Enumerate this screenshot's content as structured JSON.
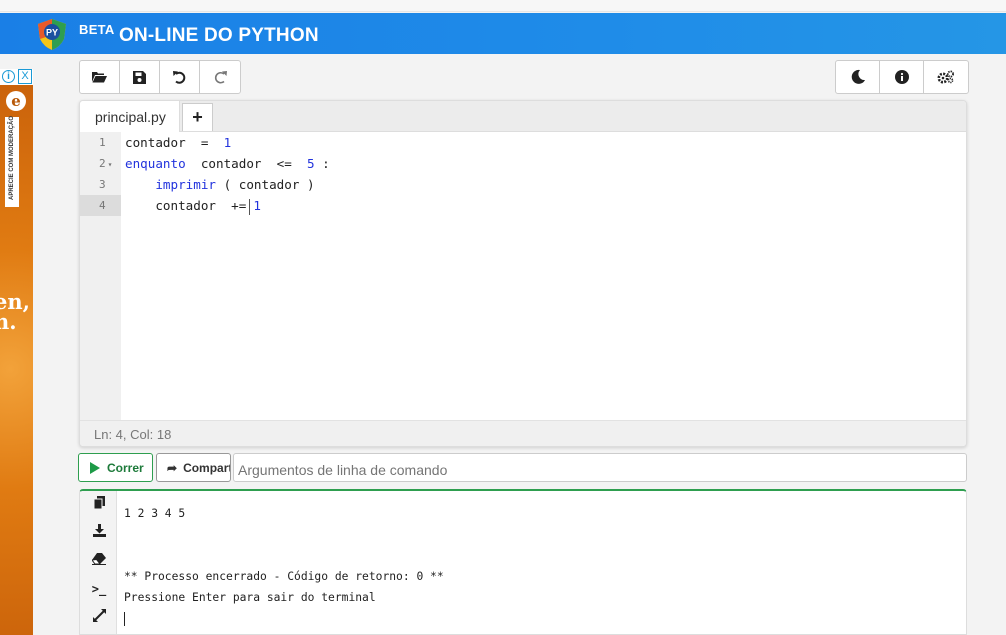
{
  "header": {
    "beta": "BETA",
    "brand": "ON-LINE DO PYTHON",
    "logo_text": "PY",
    "color": "#1f8ce8"
  },
  "ad": {
    "info": "i",
    "close": "X",
    "vertical_text": "APRECIE COM MODERAÇÃO",
    "text_line1": "en,",
    "text_line2": "n."
  },
  "toolbar_left": [
    {
      "name": "open-folder-icon"
    },
    {
      "name": "save-icon"
    },
    {
      "name": "undo-icon"
    },
    {
      "name": "redo-icon"
    }
  ],
  "toolbar_right": [
    {
      "name": "moon-icon"
    },
    {
      "name": "info-icon"
    },
    {
      "name": "settings-icon"
    }
  ],
  "editor": {
    "tab_label": "principal.py",
    "add_tab": "+",
    "line_numbers": [
      "1",
      "2",
      "3",
      "4"
    ],
    "lines": [
      {
        "a": "contador",
        "b": "  =  ",
        "c": "1"
      },
      {
        "kw": "enquanto",
        "rest": "  contador  <=  ",
        "num": "5",
        "end": " :"
      },
      {
        "indent": "    ",
        "fn": "imprimir",
        "rest": " ( contador )"
      },
      {
        "indent": "    ",
        "a": "contador  +=",
        "num": "1"
      }
    ],
    "status": "Ln: 4, Col: 18"
  },
  "actions": {
    "run_label": "Correr",
    "share_label": "Compartilhar",
    "args_placeholder": "Argumentos de linha de comando"
  },
  "terminal": {
    "output": [
      "1 2 3 4 5",
      "",
      "",
      "** Processo encerrado - Código de retorno: 0 **",
      "Pressione Enter para sair do terminal"
    ]
  }
}
